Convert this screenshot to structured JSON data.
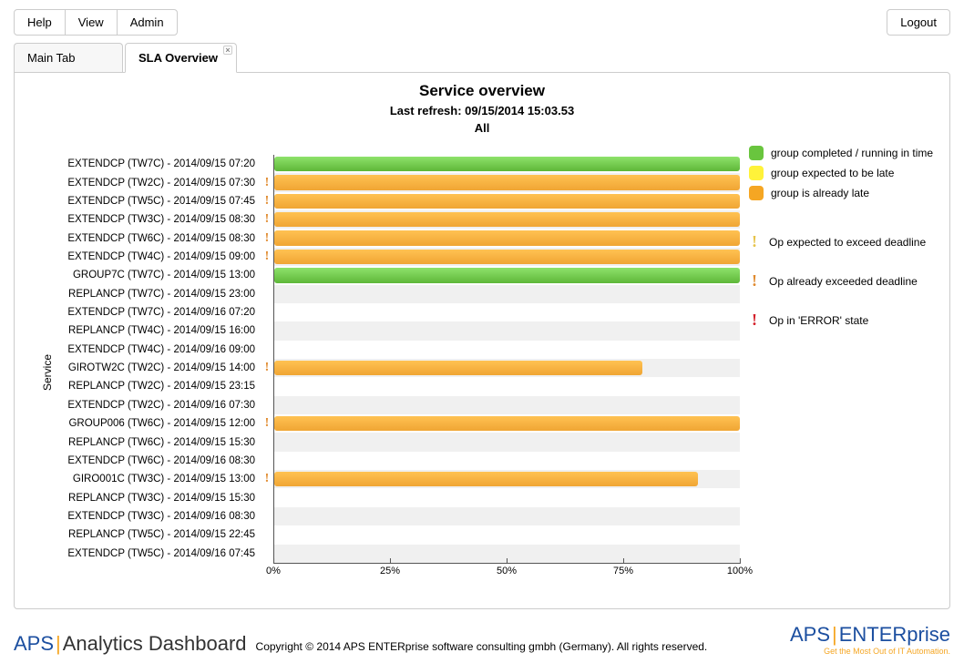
{
  "toolbar": {
    "help": "Help",
    "view": "View",
    "admin": "Admin",
    "logout": "Logout"
  },
  "tabs": [
    {
      "label": "Main Tab",
      "active": false,
      "closable": false
    },
    {
      "label": "SLA Overview",
      "active": true,
      "closable": true
    }
  ],
  "chart": {
    "title": "Service overview",
    "subtitle": "Last refresh: 09/15/2014 15:03.53",
    "filter": "All",
    "y_axis_title": "Service"
  },
  "legend_bars": [
    {
      "color": "green",
      "label": "group completed / running in time"
    },
    {
      "color": "yellow",
      "label": "group expected to be late"
    },
    {
      "color": "orange",
      "label": "group is already late"
    }
  ],
  "legend_marks": [
    {
      "color": "#e6c34a",
      "glyph": "!",
      "label": "Op expected to exceed deadline"
    },
    {
      "color": "#e08a2e",
      "glyph": "!",
      "label": "Op already exceeded deadline"
    },
    {
      "color": "#d4202a",
      "glyph": "!",
      "label": "Op in 'ERROR' state"
    }
  ],
  "x_ticks": [
    "0%",
    "25%",
    "50%",
    "75%",
    "100%"
  ],
  "chart_data": {
    "type": "bar",
    "xlabel": "",
    "ylabel": "Service",
    "xlim": [
      0,
      100
    ],
    "unit": "%",
    "series_colors": {
      "green": "#69c53e",
      "orange": "#f5a623"
    },
    "rows": [
      {
        "label": "EXTENDCP (TW7C) - 2014/09/15 07:20",
        "indicator": null,
        "value": 100,
        "color": "green"
      },
      {
        "label": "EXTENDCP (TW2C) - 2014/09/15 07:30",
        "indicator": "orange",
        "value": 100,
        "color": "orange"
      },
      {
        "label": "EXTENDCP (TW5C) - 2014/09/15 07:45",
        "indicator": "orange",
        "value": 100,
        "color": "orange"
      },
      {
        "label": "EXTENDCP (TW3C) - 2014/09/15 08:30",
        "indicator": "orange",
        "value": 100,
        "color": "orange"
      },
      {
        "label": "EXTENDCP (TW6C) - 2014/09/15 08:30",
        "indicator": "orange",
        "value": 100,
        "color": "orange"
      },
      {
        "label": "EXTENDCP (TW4C) - 2014/09/15 09:00",
        "indicator": "orange",
        "value": 100,
        "color": "orange"
      },
      {
        "label": "GROUP7C (TW7C) - 2014/09/15 13:00",
        "indicator": null,
        "value": 100,
        "color": "green"
      },
      {
        "label": "REPLANCP (TW7C) - 2014/09/15 23:00",
        "indicator": null,
        "value": 0,
        "color": null
      },
      {
        "label": "EXTENDCP (TW7C) - 2014/09/16 07:20",
        "indicator": null,
        "value": 0,
        "color": null
      },
      {
        "label": "REPLANCP (TW4C) - 2014/09/15 16:00",
        "indicator": null,
        "value": 0,
        "color": null
      },
      {
        "label": "EXTENDCP (TW4C) - 2014/09/16 09:00",
        "indicator": null,
        "value": 0,
        "color": null
      },
      {
        "label": "GIROTW2C (TW2C) - 2014/09/15 14:00",
        "indicator": "orange",
        "value": 79,
        "color": "orange"
      },
      {
        "label": "REPLANCP (TW2C) - 2014/09/15 23:15",
        "indicator": null,
        "value": 0,
        "color": null
      },
      {
        "label": "EXTENDCP (TW2C) - 2014/09/16 07:30",
        "indicator": null,
        "value": 0,
        "color": null
      },
      {
        "label": "GROUP006 (TW6C) - 2014/09/15 12:00",
        "indicator": "orange",
        "value": 100,
        "color": "orange"
      },
      {
        "label": "REPLANCP (TW6C) - 2014/09/15 15:30",
        "indicator": null,
        "value": 0,
        "color": null
      },
      {
        "label": "EXTENDCP (TW6C) - 2014/09/16 08:30",
        "indicator": null,
        "value": 0,
        "color": null
      },
      {
        "label": "GIRO001C (TW3C) - 2014/09/15 13:00",
        "indicator": "orange",
        "value": 91,
        "color": "orange"
      },
      {
        "label": "REPLANCP (TW3C) - 2014/09/15 15:30",
        "indicator": null,
        "value": 0,
        "color": null
      },
      {
        "label": "EXTENDCP (TW3C) - 2014/09/16 08:30",
        "indicator": null,
        "value": 0,
        "color": null
      },
      {
        "label": "REPLANCP (TW5C) - 2014/09/15 22:45",
        "indicator": null,
        "value": 0,
        "color": null
      },
      {
        "label": "EXTENDCP (TW5C) - 2014/09/16 07:45",
        "indicator": null,
        "value": 0,
        "color": null
      }
    ]
  },
  "footer": {
    "brand_left_1": "APS",
    "brand_left_2": "Analytics Dashboard",
    "copyright": "Copyright © 2014 APS ENTERprise software consulting gmbh (Germany). All rights reserved.",
    "brand_right_1": "APS",
    "brand_right_2": "ENTERprise",
    "tagline": "Get the Most Out of IT Automation."
  }
}
